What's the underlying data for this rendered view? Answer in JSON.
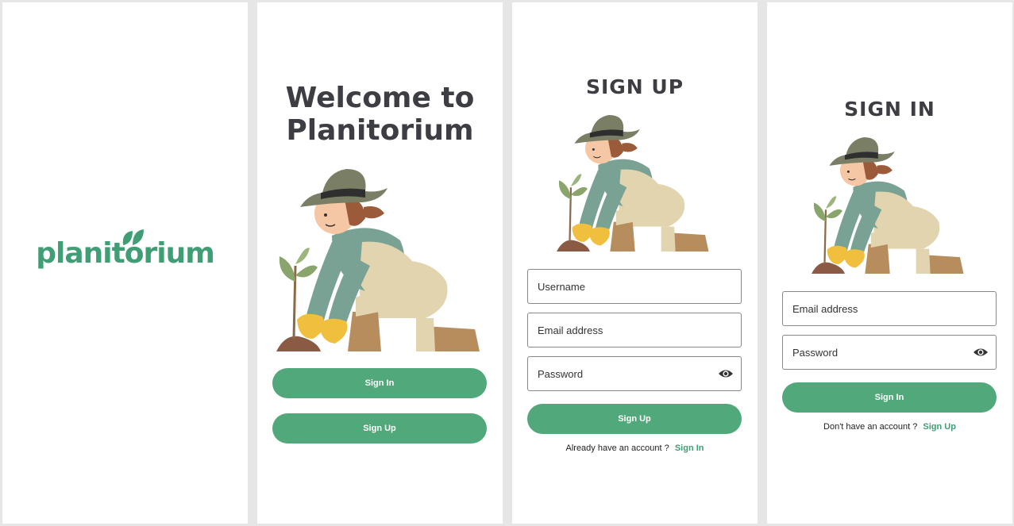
{
  "splash": {
    "logo_text": "planitorium"
  },
  "welcome": {
    "title_line1": "Welcome to",
    "title_line2": "Planitorium",
    "signin_label": "Sign In",
    "signup_label": "Sign Up"
  },
  "signup": {
    "title": "SIGN UP",
    "username_placeholder": "Username",
    "email_placeholder": "Email address",
    "password_placeholder": "Password",
    "submit_label": "Sign Up",
    "footer_text": "Already have an account ?",
    "footer_link": "Sign In"
  },
  "signin": {
    "title": "SIGN IN",
    "email_placeholder": "Email address",
    "password_placeholder": "Password",
    "submit_label": "Sign In",
    "footer_text": "Don't have an account ?",
    "footer_link": "Sign Up"
  },
  "colors": {
    "accent": "#51a87a",
    "brand": "#3f9e74",
    "title": "#3d3d44"
  },
  "icons": {
    "password_toggle": "eye-icon",
    "illustration": "gardener-planting-illustration",
    "logo_leaf": "leaf-icon"
  }
}
